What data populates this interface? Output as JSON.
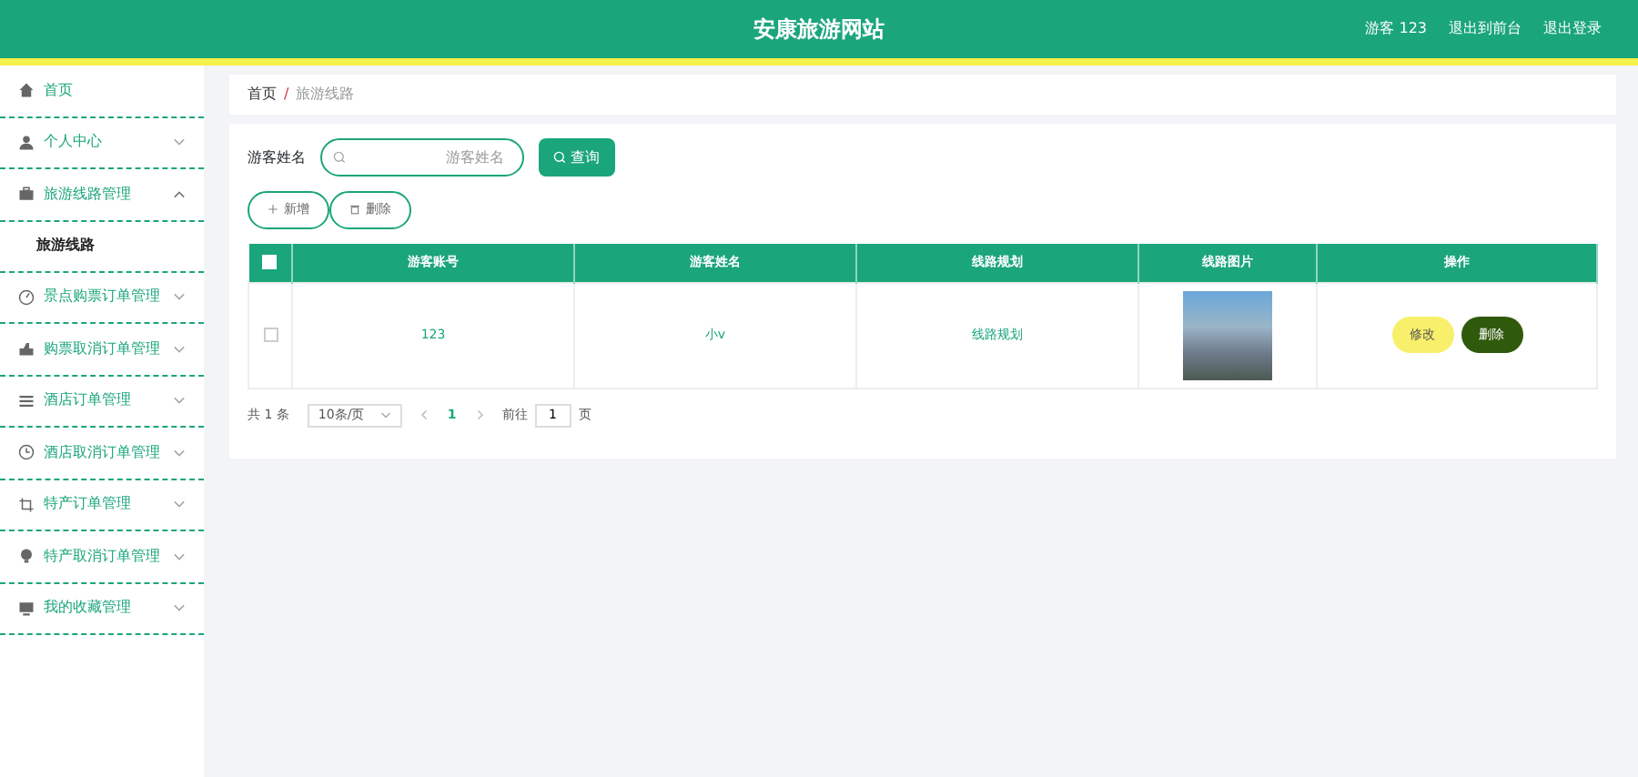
{
  "header": {
    "title": "安康旅游网站",
    "user": "游客 123",
    "links": [
      "退出到前台",
      "退出登录"
    ]
  },
  "sidebar": {
    "items": [
      {
        "label": "首页"
      },
      {
        "label": "个人中心",
        "expanded": false
      },
      {
        "label": "旅游线路管理",
        "expanded": true,
        "children": [
          {
            "label": "旅游线路",
            "selected": true
          }
        ]
      },
      {
        "label": "景点购票订单管理",
        "expanded": false
      },
      {
        "label": "购票取消订单管理",
        "expanded": false
      },
      {
        "label": "酒店订单管理",
        "expanded": false
      },
      {
        "label": "酒店取消订单管理",
        "expanded": false
      },
      {
        "label": "特产订单管理",
        "expanded": false
      },
      {
        "label": "特产取消订单管理",
        "expanded": false
      },
      {
        "label": "我的收藏管理",
        "expanded": false
      }
    ]
  },
  "breadcrumb": {
    "separator": "/",
    "items": [
      "首页",
      "旅游线路"
    ]
  },
  "search": {
    "label": "游客姓名",
    "placeholder": "游客姓名",
    "button": "查询"
  },
  "actions": [
    "新增",
    "删除"
  ],
  "table": {
    "all_checked": false,
    "columns": [
      "游客账号",
      "游客姓名",
      "线路规划",
      "线路图片",
      "操作"
    ],
    "rows": [
      {
        "checked": false,
        "cells": [
          "123",
          "小v",
          "线路规划"
        ],
        "buttons": [
          "修改",
          "删除"
        ]
      }
    ]
  },
  "pagination": {
    "total": "共 1 条",
    "page_size": "10条/页",
    "pages": [
      {
        "label": "1",
        "selected": true
      }
    ],
    "goto_label": "前往",
    "goto_value": "1",
    "goto_suffix": "页"
  }
}
